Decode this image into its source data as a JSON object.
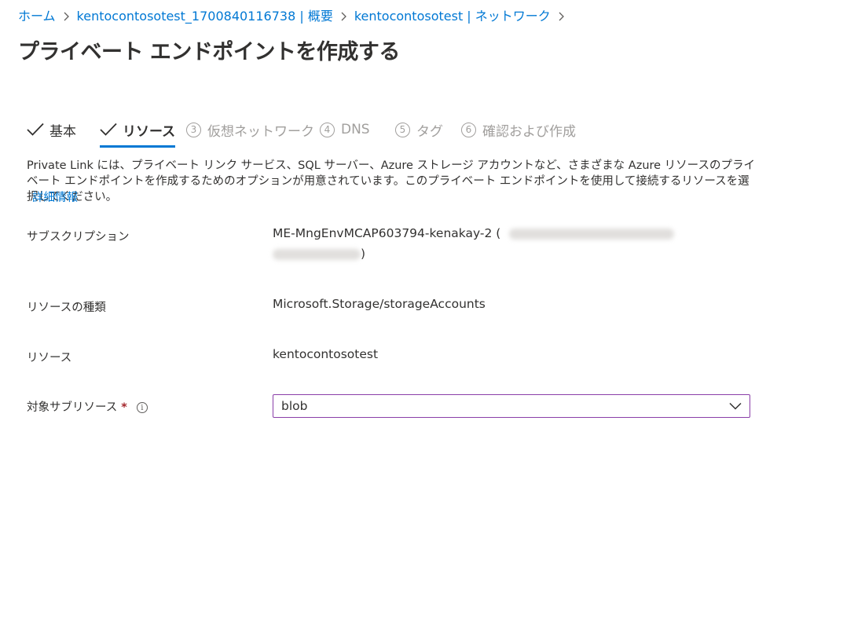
{
  "breadcrumb": {
    "items": [
      "ホーム",
      "kentocontosotest_1700840116738 | 概要",
      "kentocontosotest | ネットワーク"
    ]
  },
  "title": "プライベート エンドポイントを作成する",
  "more_label": "...",
  "tabs": [
    {
      "label": "基本",
      "state": "done"
    },
    {
      "label": "リソース",
      "state": "active"
    },
    {
      "label": "仮想ネットワーク",
      "number": "3",
      "state": "inactive"
    },
    {
      "label": "DNS",
      "number": "4",
      "state": "inactive"
    },
    {
      "label": "タグ",
      "number": "5",
      "state": "inactive"
    },
    {
      "label": "確認および作成",
      "number": "6",
      "state": "inactive"
    }
  ],
  "description": "Private Link には、プライベート リンク サービス、SQL サーバー、Azure ストレージ アカウントなど、さまざまな Azure リソースのプライベート エンドポイントを作成するためのオプションが用意されています。このプライベート エンドポイントを使用して接続するリソースを選択してください。",
  "learn_more": "詳細情報",
  "form": {
    "subscription_label": "サブスクリプション",
    "subscription_value": "ME-MngEnvMCAP603794-kenakay-2 (",
    "subscription_close": ")",
    "resource_type_label": "リソースの種類",
    "resource_type_value": "Microsoft.Storage/storageAccounts",
    "resource_label": "リソース",
    "resource_value": "kentocontosotest",
    "target_sub_label": "対象サブリソース",
    "required_mark": "*",
    "info_glyph": "i",
    "target_sub_value": "blob"
  },
  "colors": {
    "link": "#0078d4",
    "text": "#323130",
    "inactive": "#a19f9d",
    "required": "#a4262c",
    "dropdown_border": "#8a3ea8"
  }
}
